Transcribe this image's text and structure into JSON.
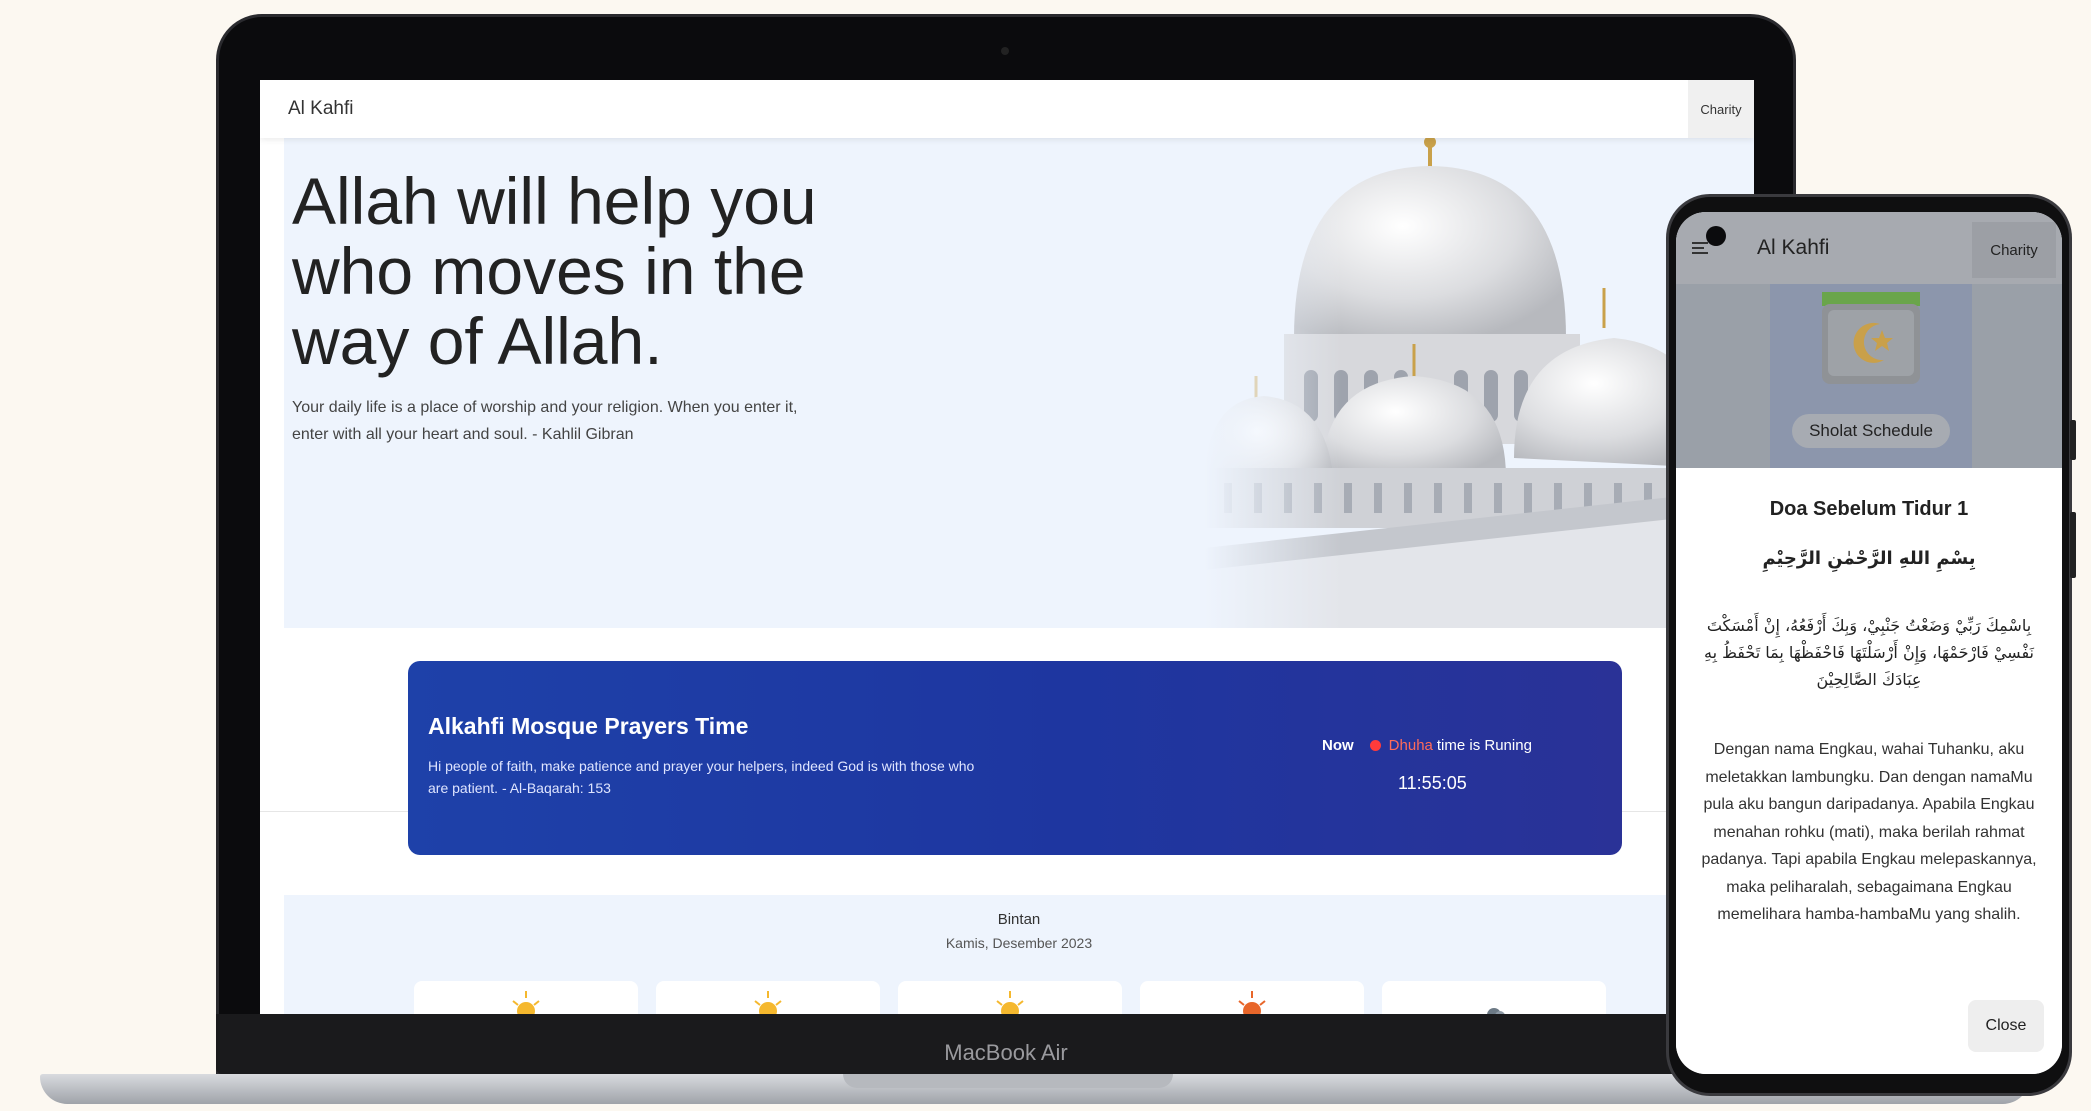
{
  "device_label": "MacBook Air",
  "web": {
    "nav": {
      "title": "Al Kahfi",
      "charity_label": "Charity"
    },
    "hero": {
      "headline": "Allah will help you who moves in the way of Allah.",
      "quote": "Your daily life is a place of worship and your religion. When you enter it, enter with all your heart and soul. - Kahlil Gibran"
    },
    "prayer_card": {
      "title": "Alkahfi Mosque Prayers Time",
      "description": "Hi people of faith, make patience and prayer your helpers, indeed God is with those who are patient. - Al-Baqarah: 153",
      "now_label": "Now",
      "current_prayer": "Dhuha",
      "running_text": "time is Runing",
      "clock": "11:55:05"
    },
    "schedule": {
      "location": "Bintan",
      "date": "Kamis, Desember 2023"
    }
  },
  "mobile": {
    "nav": {
      "title": "Al Kahfi",
      "charity_label": "Charity"
    },
    "card_label": "Sholat Schedule",
    "modal": {
      "title": "Doa Sebelum Tidur 1",
      "bismillah": "بِسْمِ اللهِ الرَّحْمٰنِ الرَّحِيْمِ",
      "arabic": "بِاسْمِكَ رَبِّيْ وَضَعْتُ جَنْبِيْ، وَبِكَ أَرْفَعُهُ، إِنْ أَمْسَكْتَ نَفْسِيْ فَارْحَمْهَا، وَإِنْ أَرْسَلْتَهَا فَاحْفَظْهَا بِمَا تَحْفَظُ بِهِ عِبَادَكَ الصَّالِحِيْنَ",
      "translation": "Dengan nama Engkau, wahai Tuhanku, aku meletakkan lambungku. Dan dengan namaMu pula aku bangun daripadanya. Apabila Engkau menahan rohku (mati), maka berilah rahmat padanya. Tapi apabila Engkau melepaskannya, maka peliharalah, sebagaimana Engkau memelihara hamba-hambaMu yang shalih.",
      "close_label": "Close"
    }
  },
  "colors": {
    "accent": "#1e3fa6",
    "now_dot": "#ff3b3b",
    "prayer_name": "#ff6b5a",
    "hero_bg": "#eef4fd"
  }
}
